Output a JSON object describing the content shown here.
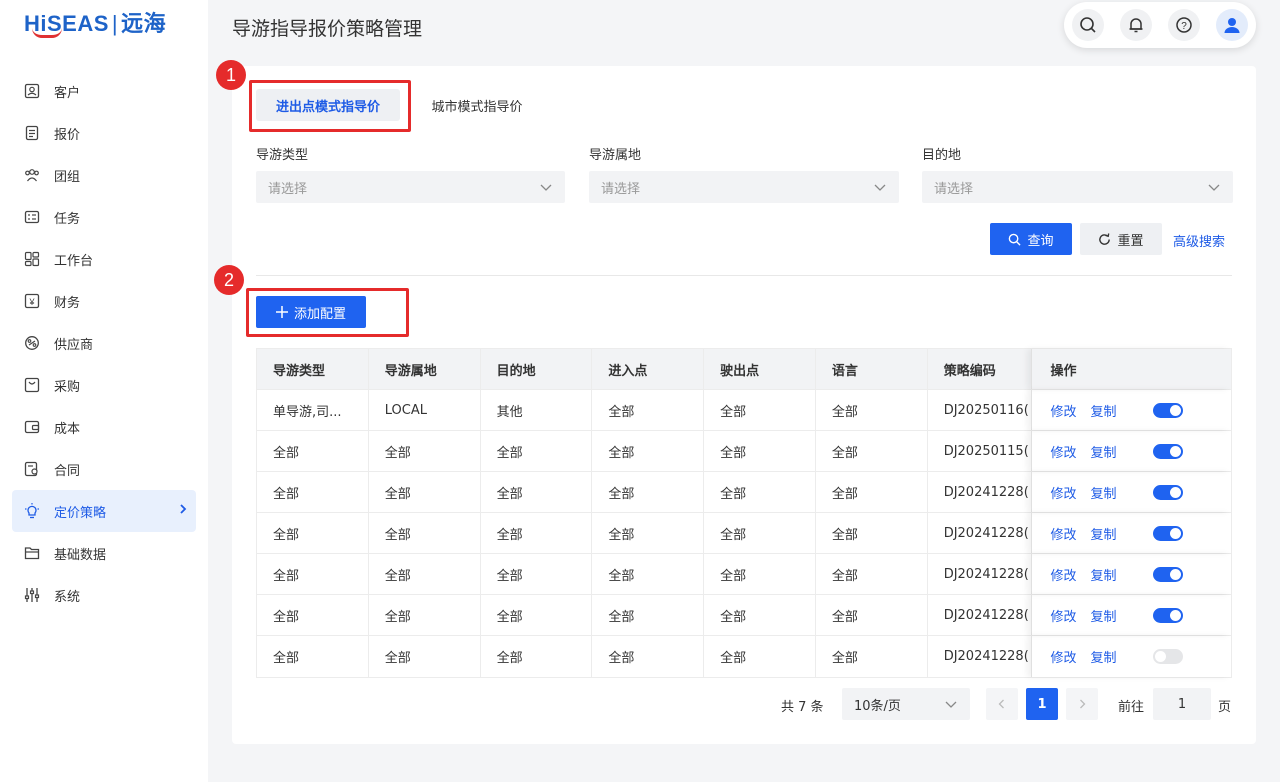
{
  "logo": {
    "brand": "HiSEAS",
    "cn": "远海"
  },
  "sidebar": {
    "items": [
      {
        "label": "客户",
        "icon": "customer-icon"
      },
      {
        "label": "报价",
        "icon": "quote-icon"
      },
      {
        "label": "团组",
        "icon": "group-icon"
      },
      {
        "label": "任务",
        "icon": "task-icon"
      },
      {
        "label": "工作台",
        "icon": "workbench-icon"
      },
      {
        "label": "财务",
        "icon": "finance-icon"
      },
      {
        "label": "供应商",
        "icon": "supplier-icon"
      },
      {
        "label": "采购",
        "icon": "purchase-icon"
      },
      {
        "label": "成本",
        "icon": "cost-icon"
      },
      {
        "label": "合同",
        "icon": "contract-icon"
      },
      {
        "label": "定价策略",
        "icon": "lightbulb-icon",
        "active": true
      },
      {
        "label": "基础数据",
        "icon": "folder-icon"
      },
      {
        "label": "系统",
        "icon": "settings-sliders-icon"
      }
    ]
  },
  "header": {
    "title": "导游指导报价策略管理"
  },
  "markers": [
    "1",
    "2"
  ],
  "tabs": [
    {
      "label": "进出点模式指导价",
      "active": true
    },
    {
      "label": "城市模式指导价",
      "active": false
    }
  ],
  "filters": [
    {
      "label": "导游类型",
      "placeholder": "请选择"
    },
    {
      "label": "导游属地",
      "placeholder": "请选择"
    },
    {
      "label": "目的地",
      "placeholder": "请选择"
    }
  ],
  "actions": {
    "query": "查询",
    "reset": "重置",
    "advanced": "高级搜索",
    "add": "添加配置"
  },
  "table": {
    "headers": [
      "导游类型",
      "导游属地",
      "目的地",
      "进入点",
      "驶出点",
      "语言",
      "策略编码",
      "操作"
    ],
    "edit_label": "修改",
    "copy_label": "复制",
    "rows": [
      {
        "c": [
          "单导游,司...",
          "LOCAL",
          "其他",
          "全部",
          "全部",
          "全部",
          "DJ20250116("
        ],
        "enabled": true
      },
      {
        "c": [
          "全部",
          "全部",
          "全部",
          "全部",
          "全部",
          "全部",
          "DJ20250115("
        ],
        "enabled": true
      },
      {
        "c": [
          "全部",
          "全部",
          "全部",
          "全部",
          "全部",
          "全部",
          "DJ20241228("
        ],
        "enabled": true
      },
      {
        "c": [
          "全部",
          "全部",
          "全部",
          "全部",
          "全部",
          "全部",
          "DJ20241228("
        ],
        "enabled": true
      },
      {
        "c": [
          "全部",
          "全部",
          "全部",
          "全部",
          "全部",
          "全部",
          "DJ20241228("
        ],
        "enabled": true
      },
      {
        "c": [
          "全部",
          "全部",
          "全部",
          "全部",
          "全部",
          "全部",
          "DJ20241228("
        ],
        "enabled": true
      },
      {
        "c": [
          "全部",
          "全部",
          "全部",
          "全部",
          "全部",
          "全部",
          "DJ20241228("
        ],
        "enabled": false
      }
    ]
  },
  "pagination": {
    "total": "共 7 条",
    "page_size": "10条/页",
    "current": "1",
    "goto_label": "前往",
    "goto_value": "1",
    "page_suffix": "页"
  }
}
